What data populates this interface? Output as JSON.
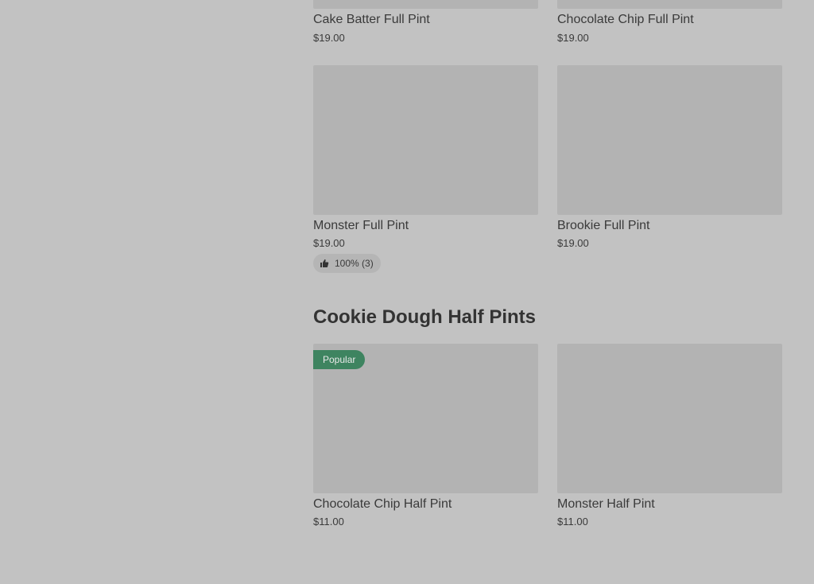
{
  "colors": {
    "background": "#c2c2c2",
    "image_placeholder": "#b3b3b3",
    "popular_badge": "#3e8460",
    "rating_pill": "#b5b5b5"
  },
  "top_row": [
    {
      "title": "Cake Batter Full Pint",
      "price": "$19.00"
    },
    {
      "title": "Chocolate Chip Full Pint",
      "price": "$19.00"
    }
  ],
  "full_pints": [
    {
      "title": "Monster Full Pint",
      "price": "$19.00",
      "rating": "100% (3)",
      "rating_icon": "thumbs-up-icon"
    },
    {
      "title": "Brookie Full Pint",
      "price": "$19.00"
    }
  ],
  "section": {
    "title": "Cookie Dough Half Pints"
  },
  "half_pints": [
    {
      "title": "Chocolate Chip Half Pint",
      "price": "$11.00",
      "badge": "Popular"
    },
    {
      "title": "Monster Half Pint",
      "price": "$11.00"
    }
  ]
}
